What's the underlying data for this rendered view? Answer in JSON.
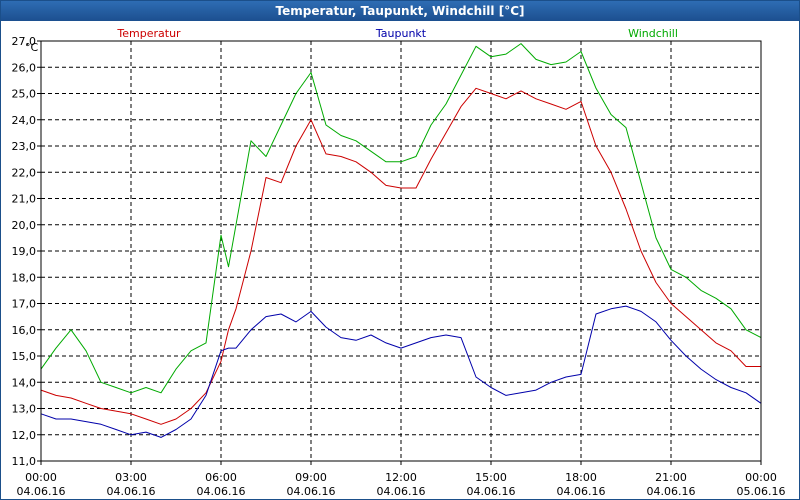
{
  "window": {
    "title": "Temperatur, Taupunkt, Windchill [°C]"
  },
  "chart_data": {
    "type": "line",
    "title": "Temperatur, Taupunkt, Windchill [°C]",
    "ylabel": "°C",
    "xlabel": "",
    "ylim": [
      11.0,
      27.0
    ],
    "y_ticks": [
      "11,0",
      "12,0",
      "13,0",
      "14,0",
      "15,0",
      "16,0",
      "17,0",
      "18,0",
      "19,0",
      "20,0",
      "21,0",
      "22,0",
      "23,0",
      "24,0",
      "25,0",
      "26,0",
      "27,0"
    ],
    "x_ticks": [
      {
        "time": "00:00",
        "date": "04.06.16"
      },
      {
        "time": "03:00",
        "date": "04.06.16"
      },
      {
        "time": "06:00",
        "date": "04.06.16"
      },
      {
        "time": "09:00",
        "date": "04.06.16"
      },
      {
        "time": "12:00",
        "date": "04.06.16"
      },
      {
        "time": "15:00",
        "date": "04.06.16"
      },
      {
        "time": "18:00",
        "date": "04.06.16"
      },
      {
        "time": "21:00",
        "date": "04.06.16"
      },
      {
        "time": "00:00",
        "date": "05.06.16"
      }
    ],
    "x_unit": "hours",
    "xlim": [
      0,
      24
    ],
    "grid": true,
    "legend_position": "top",
    "x": [
      0,
      0.5,
      1,
      1.5,
      2,
      2.5,
      3,
      3.5,
      4,
      4.5,
      5,
      5.5,
      6,
      6.25,
      6.5,
      7,
      7.5,
      8,
      8.5,
      9,
      9.5,
      10,
      10.5,
      11,
      11.5,
      12,
      12.5,
      13,
      13.5,
      14,
      14.5,
      15,
      15.5,
      16,
      16.5,
      17,
      17.5,
      18,
      18.5,
      19,
      19.5,
      20,
      20.5,
      21,
      21.5,
      22,
      22.5,
      23,
      23.5,
      24
    ],
    "series": [
      {
        "name": "Temperatur",
        "color": "#cc0000",
        "values": [
          13.7,
          13.5,
          13.4,
          13.2,
          13.0,
          12.9,
          12.8,
          12.6,
          12.4,
          12.6,
          13.0,
          13.6,
          14.8,
          16.0,
          16.8,
          19.0,
          21.8,
          21.6,
          23.0,
          24.0,
          22.7,
          22.6,
          22.4,
          22.0,
          21.5,
          21.4,
          21.4,
          22.5,
          23.5,
          24.5,
          25.2,
          25.0,
          24.8,
          25.1,
          24.8,
          24.6,
          24.4,
          24.7,
          23.0,
          22.0,
          20.6,
          19.0,
          17.8,
          17.0,
          16.5,
          16.0,
          15.5,
          15.2,
          14.6,
          14.6
        ]
      },
      {
        "name": "Taupunkt",
        "color": "#0000aa",
        "values": [
          12.8,
          12.6,
          12.6,
          12.5,
          12.4,
          12.2,
          12.0,
          12.1,
          11.9,
          12.2,
          12.6,
          13.5,
          15.2,
          15.3,
          15.3,
          16.0,
          16.5,
          16.6,
          16.3,
          16.7,
          16.1,
          15.7,
          15.6,
          15.8,
          15.5,
          15.3,
          15.5,
          15.7,
          15.8,
          15.7,
          14.2,
          13.8,
          13.5,
          13.6,
          13.7,
          14.0,
          14.2,
          14.3,
          16.6,
          16.8,
          16.9,
          16.7,
          16.3,
          15.6,
          15.0,
          14.5,
          14.1,
          13.8,
          13.6,
          13.2
        ]
      },
      {
        "name": "Windchill",
        "color": "#00aa00",
        "values": [
          14.5,
          15.3,
          16.0,
          15.2,
          14.0,
          13.8,
          13.6,
          13.8,
          13.6,
          14.5,
          15.2,
          15.5,
          19.6,
          18.4,
          20.0,
          23.2,
          22.6,
          23.8,
          25.0,
          25.8,
          23.8,
          23.4,
          23.2,
          22.8,
          22.4,
          22.4,
          22.6,
          23.8,
          24.6,
          25.7,
          26.8,
          26.4,
          26.5,
          26.9,
          26.3,
          26.1,
          26.2,
          26.6,
          25.2,
          24.2,
          23.7,
          21.6,
          19.5,
          18.3,
          18.0,
          17.5,
          17.2,
          16.8,
          16.0,
          15.7
        ]
      }
    ]
  }
}
